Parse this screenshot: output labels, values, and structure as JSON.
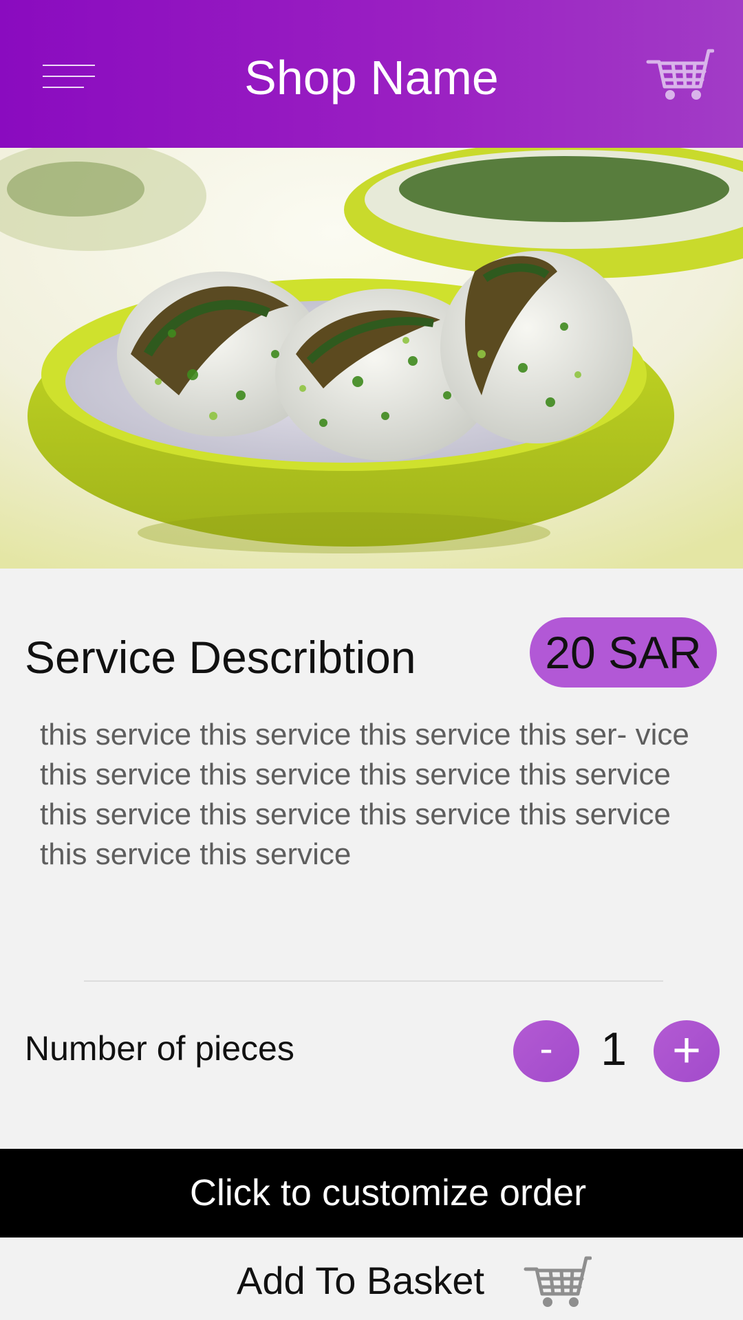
{
  "header": {
    "title": "Shop Name",
    "menu_icon": "hamburger-menu-icon",
    "cart_icon": "shopping-cart-icon"
  },
  "hero": {
    "image": "sushi-rolls-in-green-bowl-photo"
  },
  "service": {
    "title": "Service Describtion",
    "price": "20 SAR",
    "description": "this service this service this service this ser- vice this service this service this service this service this service this service this service this service this service this service"
  },
  "quantity": {
    "label": "Number of pieces",
    "minus": "-",
    "value": "1",
    "plus": "+"
  },
  "actions": {
    "customize_label": "Click to customize order",
    "add_to_basket_label": "Add To Basket",
    "basket_icon": "shopping-cart-icon"
  },
  "colors": {
    "header_start": "#8a0bbf",
    "header_end": "#a23cc6",
    "accent": "#b258d6",
    "bar": "#000000",
    "background": "#f2f2f2"
  }
}
